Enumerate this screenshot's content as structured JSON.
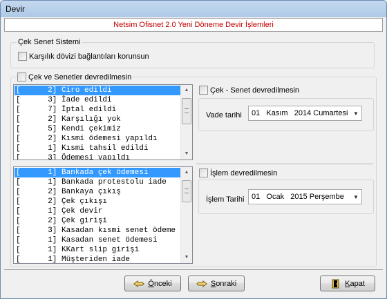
{
  "window": {
    "title": "Devir"
  },
  "header": {
    "text": "Netsim Ofisnet 2.0 Yeni Döneme Devir İşlemleri"
  },
  "cek_senet_sistemi": {
    "legend": "Çek Senet Sistemi",
    "karsilik_label": "Karşılık dövizi bağlantıları korunsun"
  },
  "cek_senet_devredilmesin": {
    "label": "Çek ve Senetler devredilmesin"
  },
  "list1": {
    "items": [
      "[      2] Ciro edildi",
      "[      3] İade edildi",
      "[      7] İptal edildi",
      "[      2] Karşılığı yok",
      "[      5] Kendi çekimiz",
      "[      2] Kısmi ödemesi yapıldı",
      "[      1] Kısmi tahsil edildi",
      "[      3] Ödemesi yapıldı"
    ]
  },
  "list2": {
    "items": [
      "[      1] Bankada çek ödemesi",
      "[      1] Bankada protestolu iade",
      "[      2] Bankaya çıkış",
      "[      2] Çek çıkışı",
      "[      1] Çek devir",
      "[      2] Çek girişi",
      "[      3] Kasadan kısmi senet ödeme",
      "[      1] Kasadan senet ödemesi",
      "[      1] KKart slip girişi",
      "[      1] Müşteriden iade"
    ]
  },
  "cek_senet_panel": {
    "checkbox_label": "Çek - Senet devredilmesin",
    "vade_label": "Vade tarihi",
    "vade_value": "01   Kasım   2014 Cumartesi"
  },
  "islem_panel": {
    "checkbox_label": "İşlem devredilmesin",
    "tarih_label": "İşlem Tarihi",
    "tarih_value": "01   Ocak   2015 Perşembe"
  },
  "buttons": {
    "onceki_label_u": "Ö",
    "onceki_label_rest": "nceki",
    "sonraki_label_u": "S",
    "sonraki_label_rest": "onraki",
    "kapat_label_u": "K",
    "kapat_label_rest": "apat"
  },
  "icons": {
    "prev": "hand-pointing-left-icon",
    "next": "hand-pointing-right-icon",
    "close": "door-exit-icon"
  },
  "colors": {
    "header_text": "#c00000",
    "selection": "#3399ff",
    "titlebar": "#b9d1ea"
  }
}
